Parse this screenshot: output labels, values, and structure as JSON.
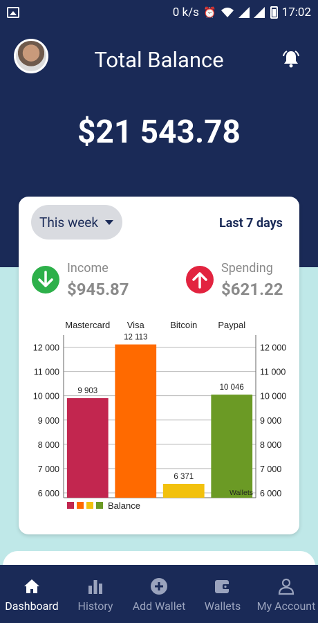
{
  "status_bar": {
    "speed": "0 k/s",
    "time": "17:02",
    "icons": [
      "gallery-icon",
      "alarm-icon",
      "wifi-icon",
      "signal-icon",
      "battery-icon"
    ]
  },
  "header": {
    "title": "Total Balance",
    "balance": "$21 543.78"
  },
  "summary": {
    "period_label": "This week",
    "range_label": "Last 7 days",
    "income_label": "Income",
    "income_value": "$945.87",
    "spending_label": "Spending",
    "spending_value": "$621.22"
  },
  "chart_data": {
    "type": "bar",
    "categories": [
      "Mastercard",
      "Visa",
      "Bitcoin",
      "Paypal"
    ],
    "series": [
      {
        "name": "Balance",
        "values": [
          9903,
          12113,
          6371,
          10046
        ]
      }
    ],
    "value_labels": [
      "9 903",
      "12 113",
      "6 371",
      "10 046"
    ],
    "ylim": [
      5800,
      12500
    ],
    "yticks": [
      6000,
      7000,
      8000,
      9000,
      10000,
      11000,
      12000
    ],
    "ytick_labels": [
      "6 000",
      "7 000",
      "8 000",
      "9 000",
      "10 000",
      "11 000",
      "12 000"
    ],
    "colors": [
      "#c2264f",
      "#ff6a00",
      "#f2c10e",
      "#6b9a25"
    ],
    "xlabel": "Wallets",
    "legend": "Balance",
    "legend_position": "bottom-left",
    "grid": true,
    "axis_right": true
  },
  "nav": [
    {
      "label": "Dashboard",
      "icon": "home-icon",
      "active": true
    },
    {
      "label": "History",
      "icon": "bar-chart-icon",
      "active": false
    },
    {
      "label": "Add Wallet",
      "icon": "plus-circle-icon",
      "active": false
    },
    {
      "label": "Wallets",
      "icon": "wallet-icon",
      "active": false
    },
    {
      "label": "My Account",
      "icon": "user-icon",
      "active": false
    }
  ]
}
